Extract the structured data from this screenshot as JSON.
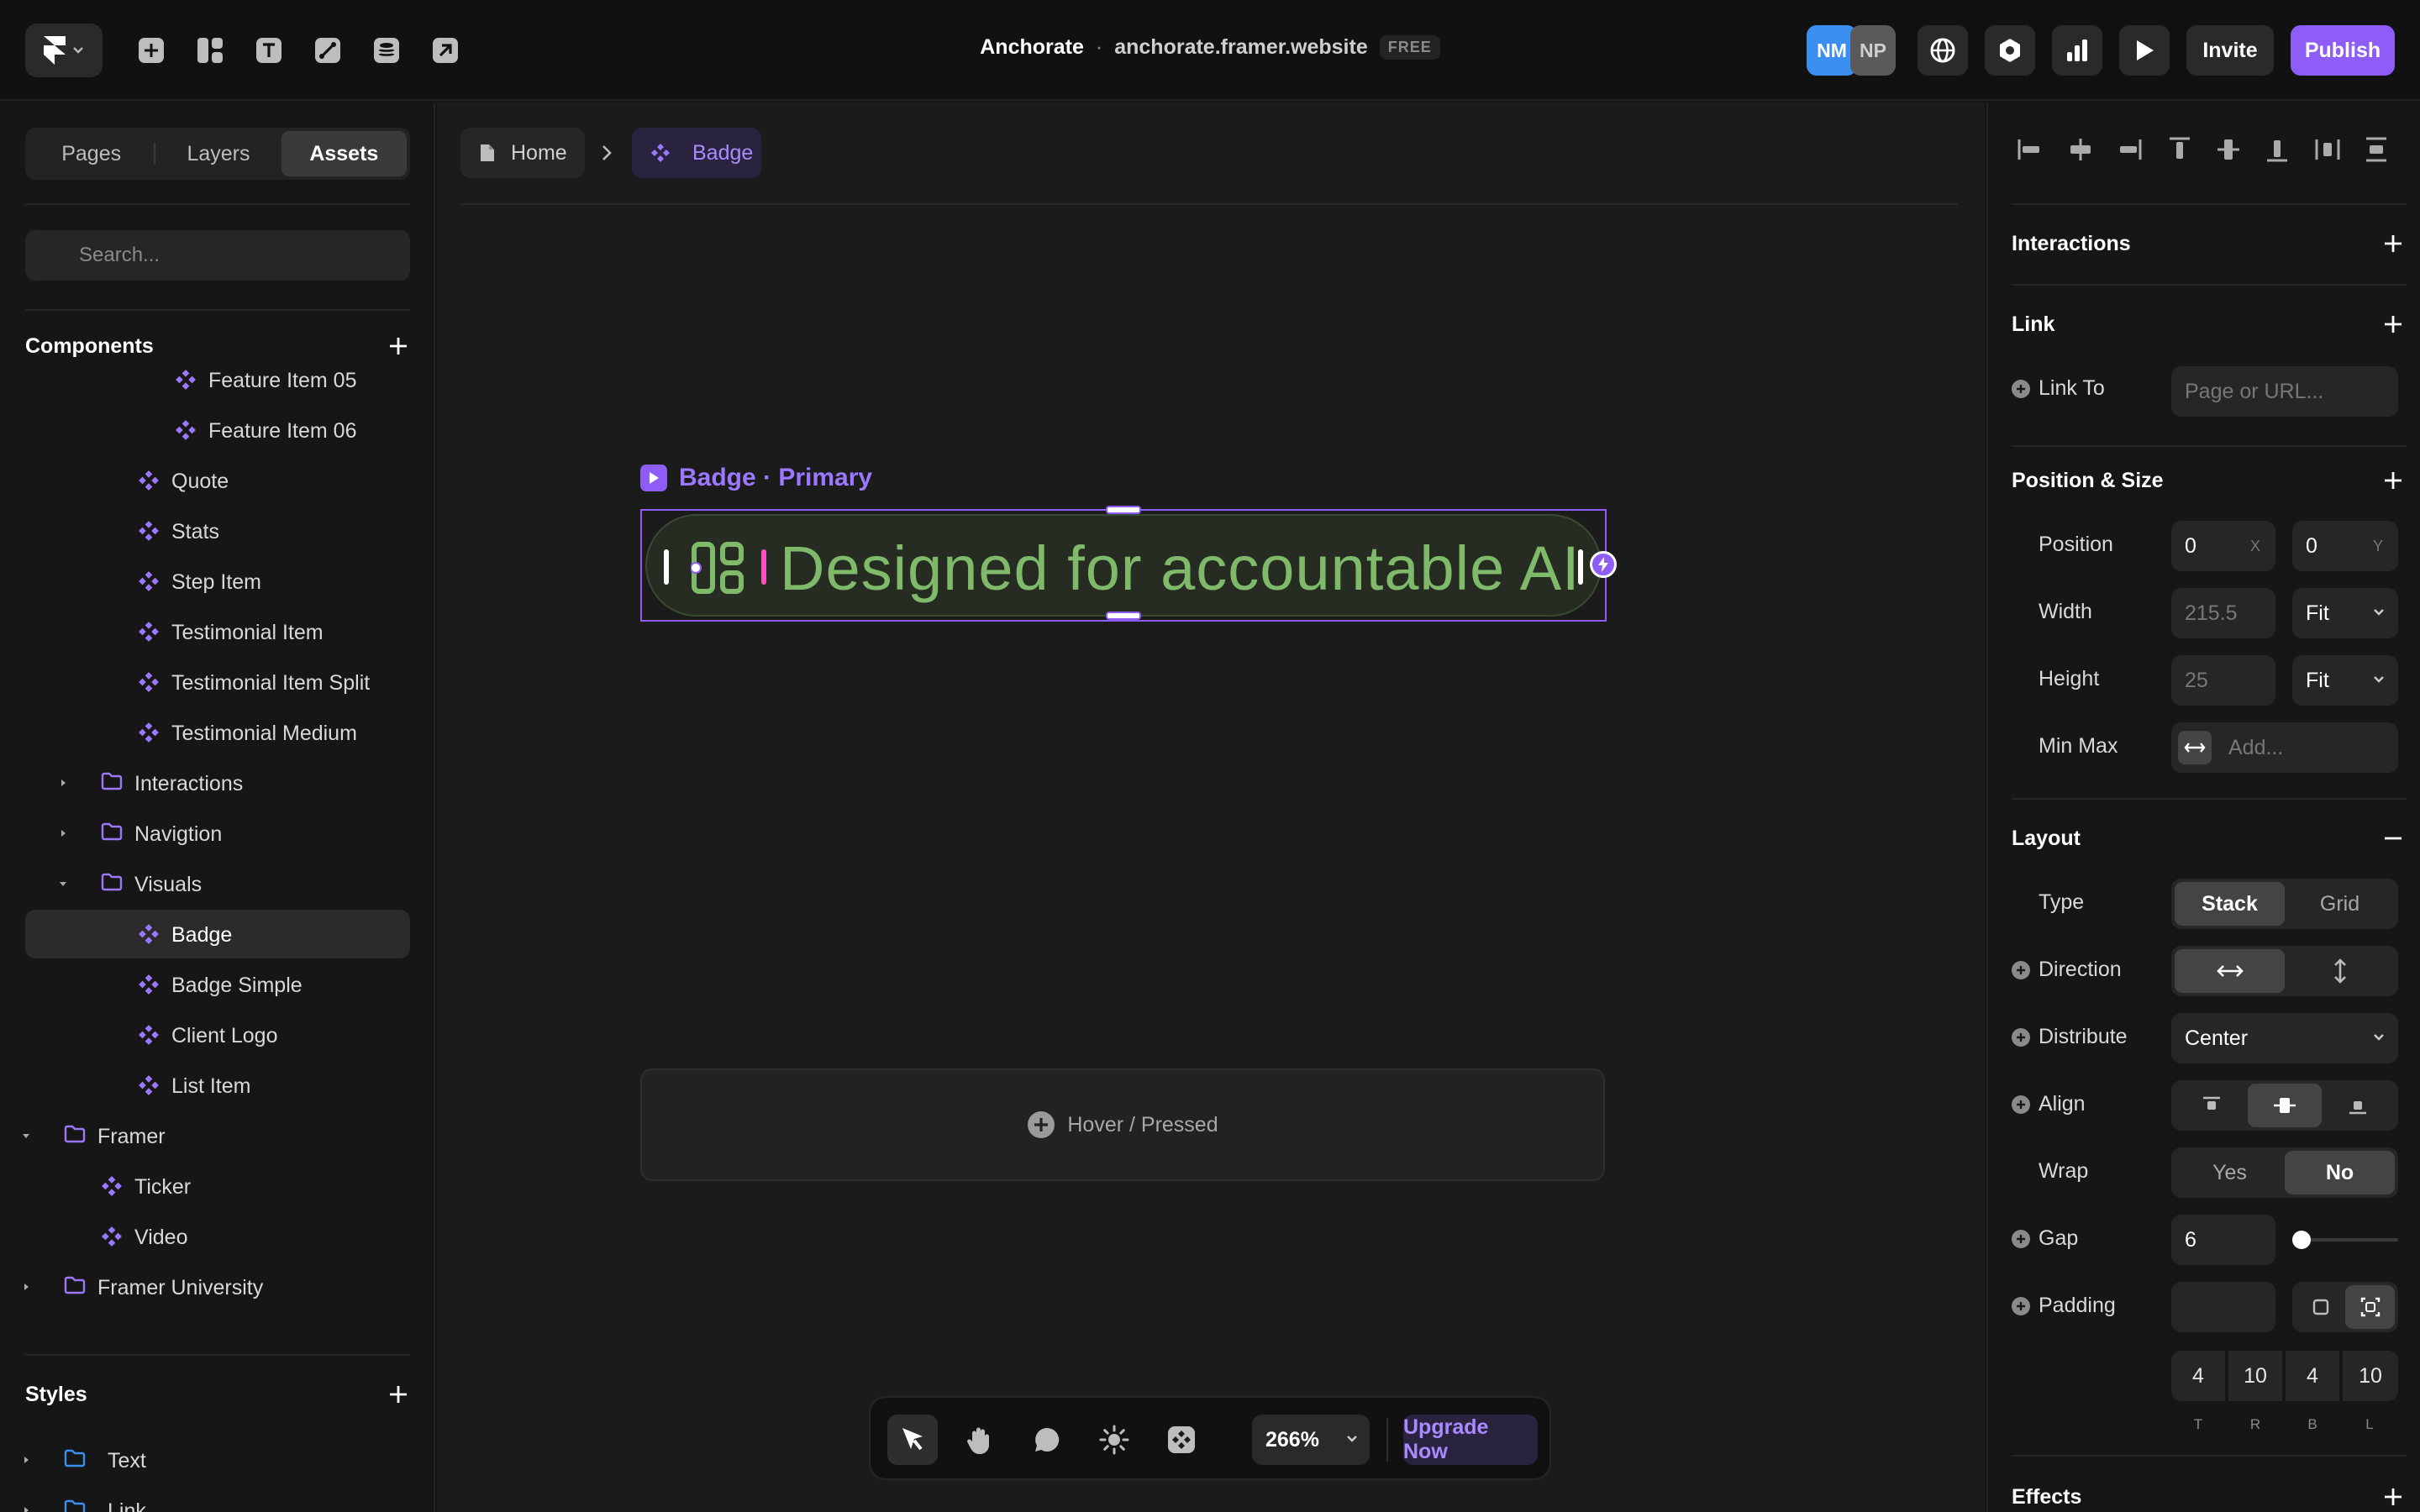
{
  "topbar": {
    "project_name": "Anchorate",
    "separator": "·",
    "site_url": "anchorate.framer.website",
    "plan_badge": "FREE",
    "avatars": [
      {
        "initials": "NM",
        "color": "#3b8ff0"
      },
      {
        "initials": "NP",
        "color": "#5a5a5a"
      }
    ],
    "invite_label": "Invite",
    "publish_label": "Publish",
    "accent_color": "#8e5cf7"
  },
  "left": {
    "tabs": [
      {
        "label": "Pages",
        "active": false
      },
      {
        "label": "Layers",
        "active": false
      },
      {
        "label": "Assets",
        "active": true
      }
    ],
    "search_placeholder": "Search...",
    "components_title": "Components",
    "tree": [
      {
        "label": "Feature Item 05",
        "type": "component"
      },
      {
        "label": "Feature Item 06",
        "type": "component"
      },
      {
        "label": "Quote",
        "type": "component"
      },
      {
        "label": "Stats",
        "type": "component"
      },
      {
        "label": "Step Item",
        "type": "component"
      },
      {
        "label": "Testimonial Item",
        "type": "component"
      },
      {
        "label": "Testimonial Item Split",
        "type": "component"
      },
      {
        "label": "Testimonial Medium",
        "type": "component"
      },
      {
        "label": "Interactions",
        "type": "folder",
        "expanded": false
      },
      {
        "label": "Navigtion",
        "type": "folder",
        "expanded": false
      },
      {
        "label": "Visuals",
        "type": "folder",
        "expanded": true
      },
      {
        "label": "Badge",
        "type": "component",
        "selected": true
      },
      {
        "label": "Badge Simple",
        "type": "component"
      },
      {
        "label": "Client Logo",
        "type": "component"
      },
      {
        "label": "List Item",
        "type": "component"
      },
      {
        "label": "Framer",
        "type": "folder",
        "expanded": true
      },
      {
        "label": "Ticker",
        "type": "component"
      },
      {
        "label": "Video",
        "type": "component"
      },
      {
        "label": "Framer University",
        "type": "folder",
        "expanded": false
      }
    ],
    "styles_title": "Styles",
    "styles_tree": [
      {
        "label": "Text",
        "type": "style-folder"
      },
      {
        "label": "Link",
        "type": "style-folder"
      }
    ]
  },
  "canvas": {
    "breadcrumb": {
      "home": "Home",
      "current": "Badge"
    },
    "variant_label": "Badge · Primary",
    "badge_text": "Designed for accountable AI",
    "hover_label": "Hover / Pressed",
    "zoom_label": "266%",
    "upgrade_label": "Upgrade Now"
  },
  "right": {
    "interactions_title": "Interactions",
    "link_title": "Link",
    "link_to_label": "Link To",
    "link_to_placeholder": "Page or URL...",
    "position_title": "Position & Size",
    "position_label": "Position",
    "position_x": "0",
    "position_x_suffix": "X",
    "position_y": "0",
    "position_y_suffix": "Y",
    "width_label": "Width",
    "width_value": "215.5",
    "width_mode": "Fit",
    "height_label": "Height",
    "height_value": "25",
    "height_mode": "Fit",
    "minmax_label": "Min Max",
    "minmax_placeholder": "Add...",
    "layout_title": "Layout",
    "type_label": "Type",
    "type_options": [
      "Stack",
      "Grid"
    ],
    "type_selected": "Stack",
    "direction_label": "Direction",
    "distribute_label": "Distribute",
    "distribute_value": "Center",
    "align_label": "Align",
    "wrap_label": "Wrap",
    "wrap_options": [
      "Yes",
      "No"
    ],
    "wrap_selected": "No",
    "gap_label": "Gap",
    "gap_value": "6",
    "padding_label": "Padding",
    "padding_values": {
      "t": "4",
      "r": "10",
      "b": "4",
      "l": "10"
    },
    "padding_labels": {
      "t": "T",
      "r": "R",
      "b": "B",
      "l": "L"
    },
    "effects_title": "Effects"
  }
}
